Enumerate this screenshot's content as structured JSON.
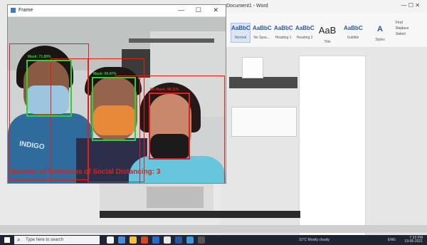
{
  "frame_window": {
    "title": "Frame",
    "controls": [
      "—",
      "☐",
      "✕"
    ]
  },
  "detections": [
    {
      "label": "Mask: 71.89%",
      "status": "masked"
    },
    {
      "label": "Mask: 99.47%",
      "status": "masked"
    },
    {
      "label": "No Mask: 98.11%",
      "status": "no-mask"
    }
  ],
  "shirt_text": "INDIGO",
  "violations_text": "Number of Violations of Social Distancing: 3",
  "word": {
    "title": "Document1 - Word",
    "controls": "—  ☐  ✕",
    "styles": [
      {
        "preview": "AaBbC",
        "name": "Normal"
      },
      {
        "preview": "AaBbC",
        "name": "No Spac..."
      },
      {
        "preview": "AaBbC",
        "name": "Heading 1"
      },
      {
        "preview": "AaBbC",
        "name": "Heading 2"
      },
      {
        "preview": "AaB",
        "name": "Title"
      },
      {
        "preview": "AaBbC",
        "name": "Subtitle"
      }
    ],
    "editing": [
      "Find",
      "Replace",
      "Select"
    ],
    "styles_pane": "Styles"
  },
  "taskbar": {
    "search_placeholder": "Type here to search",
    "weather": "31°C  Mostly cloudy",
    "time": "7:33 PM",
    "date": "19-06-2021",
    "lang": "ENG"
  },
  "colors": {
    "detection_red": "#e0201b",
    "detection_green": "#2ed12e",
    "taskbar": "#1f2433"
  }
}
